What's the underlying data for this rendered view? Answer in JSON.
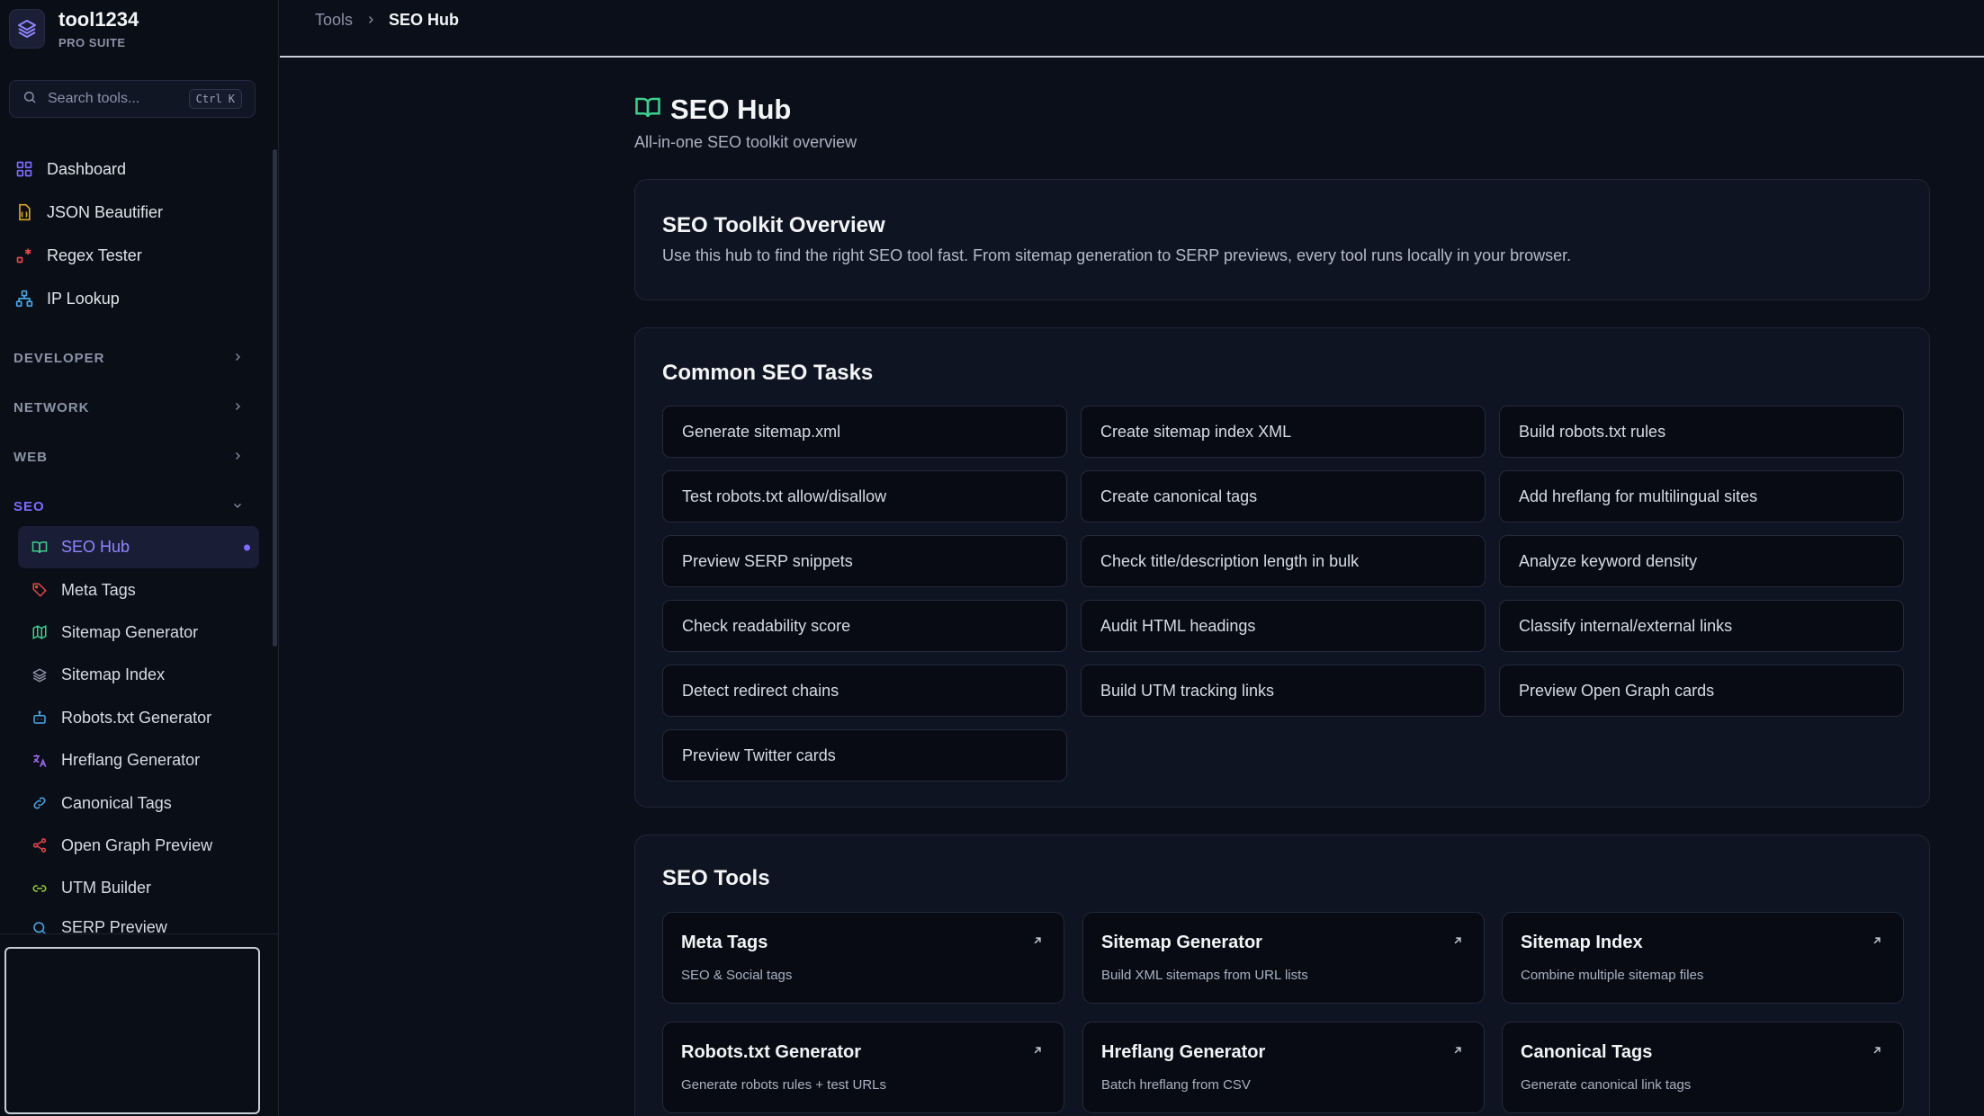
{
  "brand": {
    "name": "tool1234",
    "sub": "PRO SUITE"
  },
  "search": {
    "placeholder": "Search tools...",
    "shortcut": "Ctrl K"
  },
  "nav_top": [
    {
      "label": "Dashboard",
      "icon": "grid-icon",
      "color": "#7c6cff"
    },
    {
      "label": "JSON Beautifier",
      "icon": "file-json-icon",
      "color": "#d4a72c"
    },
    {
      "label": "Regex Tester",
      "icon": "regex-icon",
      "color": "#e5484d"
    },
    {
      "label": "IP Lookup",
      "icon": "network-icon",
      "color": "#4aa8e8"
    }
  ],
  "groups": [
    {
      "label": "DEVELOPER",
      "expanded": false
    },
    {
      "label": "NETWORK",
      "expanded": false
    },
    {
      "label": "WEB",
      "expanded": false
    },
    {
      "label": "SEO",
      "expanded": true
    }
  ],
  "seo_items": [
    {
      "label": "SEO Hub",
      "icon": "book-open-icon",
      "color": "#3ecf8e",
      "active": true
    },
    {
      "label": "Meta Tags",
      "icon": "tag-icon",
      "color": "#e5484d"
    },
    {
      "label": "Sitemap Generator",
      "icon": "map-icon",
      "color": "#3ecf8e"
    },
    {
      "label": "Sitemap Index",
      "icon": "layers-icon",
      "color": "#8b93a7"
    },
    {
      "label": "Robots.txt Generator",
      "icon": "bot-icon",
      "color": "#4aa8e8"
    },
    {
      "label": "Hreflang Generator",
      "icon": "languages-icon",
      "color": "#a06cf0"
    },
    {
      "label": "Canonical Tags",
      "icon": "link-icon",
      "color": "#4aa8e8"
    },
    {
      "label": "Open Graph Preview",
      "icon": "share-icon",
      "color": "#e5484d"
    },
    {
      "label": "UTM Builder",
      "icon": "link-chain-icon",
      "color": "#9ccf3e"
    },
    {
      "label": "SERP Preview",
      "icon": "search-icon",
      "color": "#4aa8e8"
    }
  ],
  "breadcrumb": {
    "root": "Tools",
    "current": "SEO Hub"
  },
  "page": {
    "title": "SEO Hub",
    "subtitle": "All-in-one SEO toolkit overview",
    "icon_color": "#3ecf8e"
  },
  "overview": {
    "title": "SEO Toolkit Overview",
    "desc": "Use this hub to find the right SEO tool fast. From sitemap generation to SERP previews, every tool runs locally in your browser."
  },
  "tasks": {
    "title": "Common SEO Tasks",
    "items": [
      "Generate sitemap.xml",
      "Create sitemap index XML",
      "Build robots.txt rules",
      "Test robots.txt allow/disallow",
      "Create canonical tags",
      "Add hreflang for multilingual sites",
      "Preview SERP snippets",
      "Check title/description length in bulk",
      "Analyze keyword density",
      "Check readability score",
      "Audit HTML headings",
      "Classify internal/external links",
      "Detect redirect chains",
      "Build UTM tracking links",
      "Preview Open Graph cards",
      "Preview Twitter cards"
    ]
  },
  "tools": {
    "title": "SEO Tools",
    "items": [
      {
        "name": "Meta Tags",
        "desc": "SEO & Social tags"
      },
      {
        "name": "Sitemap Generator",
        "desc": "Build XML sitemaps from URL lists"
      },
      {
        "name": "Sitemap Index",
        "desc": "Combine multiple sitemap files"
      },
      {
        "name": "Robots.txt Generator",
        "desc": "Generate robots rules + test URLs"
      },
      {
        "name": "Hreflang Generator",
        "desc": "Batch hreflang from CSV"
      },
      {
        "name": "Canonical Tags",
        "desc": "Generate canonical link tags"
      }
    ]
  }
}
